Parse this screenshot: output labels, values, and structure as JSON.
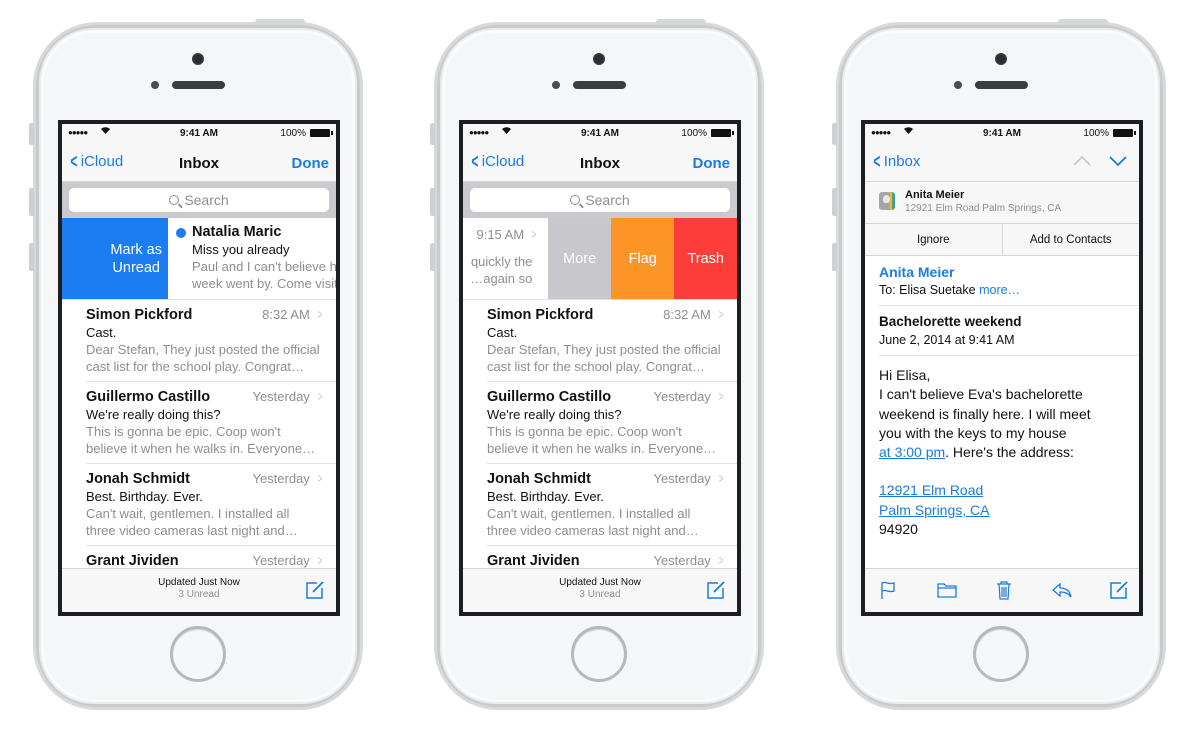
{
  "status_bar": {
    "signal": "●●●●●",
    "wifi_icon": "wifi-icon",
    "time": "9:41 AM",
    "battery_pct": "100%"
  },
  "colors": {
    "ios_blue": "#1a7ce0",
    "mark_unread": "#1b7df1",
    "more_gray": "#c7c7cc",
    "flag_orange": "#fd9426",
    "trash_red": "#fc3d39"
  },
  "inbox": {
    "back_label": "iCloud",
    "title": "Inbox",
    "done_label": "Done",
    "search_placeholder": "Search",
    "messages": [
      {
        "sender": "Natalia Maric",
        "date": "9:15 AM",
        "subject": "Miss you already",
        "preview": "Paul and I can't believe how quickly the week went by. Come visit us again so...",
        "preview_line1": "Paul and I can't believe how quickly the",
        "preview_line2": "week went by. Come visit us again so...",
        "unread": true
      },
      {
        "sender": "Simon Pickford",
        "date": "8:32 AM",
        "subject": "Cast.",
        "preview_line1": "Dear Stefan, They just posted the official",
        "preview_line2": "cast list for the school play. Congrat…"
      },
      {
        "sender": "Guillermo Castillo",
        "date": "Yesterday",
        "subject": "We're really doing this?",
        "preview_line1": "This is gonna be epic. Coop won't",
        "preview_line2": "believe it when he walks in. Everyone…"
      },
      {
        "sender": "Jonah Schmidt",
        "date": "Yesterday",
        "subject": "Best. Birthday. Ever.",
        "preview_line1": "Can't wait, gentlemen. I installed all",
        "preview_line2": "three video cameras last night and…"
      },
      {
        "sender": "Grant Jividen",
        "date": "Yesterday"
      }
    ],
    "swipe_right_action": {
      "line1": "Mark as",
      "line2": "Unread"
    },
    "swipe_left_actions": [
      "More",
      "Flag",
      "Trash"
    ],
    "swiped_left_preview_line1": "quickly the",
    "swiped_left_preview_line2": "again so…",
    "toolbar": {
      "status": "Updated Just Now",
      "unread": "3 Unread",
      "compose_icon": "compose-icon"
    }
  },
  "detail": {
    "back_label": "Inbox",
    "contact_banner": {
      "name": "Anita Meier",
      "address": "12921 Elm Road Palm Springs, CA",
      "ignore_label": "Ignore",
      "add_label": "Add to Contacts"
    },
    "from": "Anita Meier",
    "to_prefix": "To: Elisa Suetake",
    "to_more": "more…",
    "subject": "Bachelorette weekend",
    "date": "June 2, 2014 at 9:41 AM",
    "body": {
      "greeting": "Hi Elisa,",
      "line1": "I can't believe Eva's bachelorette",
      "line2": "weekend is finally here. I will meet",
      "line3": "you with the keys to my house",
      "time_link": "at 3:00 pm",
      "line4_rest": ". Here's the address:",
      "address_link1": "12921 Elm Road",
      "address_link2": "Palm Springs, CA",
      "zip": "94920"
    },
    "toolbar_icons": [
      "flag-icon",
      "folder-icon",
      "trash-icon",
      "reply-icon",
      "compose-icon"
    ]
  }
}
